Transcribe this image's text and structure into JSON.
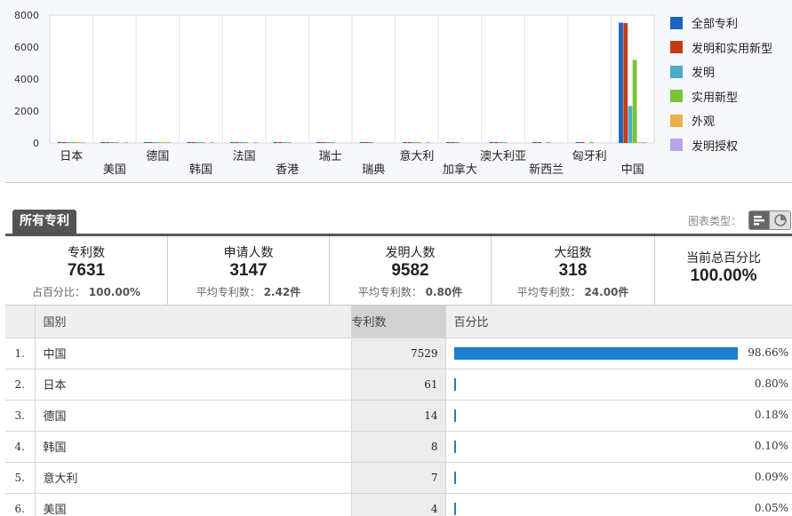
{
  "chart_data": {
    "type": "bar",
    "categories": [
      "日本",
      "美国",
      "德国",
      "韩国",
      "法国",
      "香港",
      "瑞士",
      "瑞典",
      "意大利",
      "加拿大",
      "澳大利亚",
      "新西兰",
      "匈牙利",
      "中国"
    ],
    "series": [
      {
        "name": "全部专利",
        "color": "#1b63c4",
        "values": [
          61,
          4,
          14,
          8,
          3,
          2,
          2,
          1,
          7,
          1,
          2,
          1,
          1,
          7529
        ]
      },
      {
        "name": "发明和实用新型",
        "color": "#c33b14",
        "values": [
          55,
          4,
          12,
          8,
          3,
          2,
          2,
          1,
          6,
          1,
          2,
          1,
          1,
          7500
        ]
      },
      {
        "name": "发明",
        "color": "#4bacc6",
        "values": [
          40,
          3,
          10,
          6,
          2,
          1,
          1,
          1,
          5,
          1,
          1,
          0,
          0,
          2320
        ]
      },
      {
        "name": "实用新型",
        "color": "#79c436",
        "values": [
          15,
          1,
          2,
          2,
          1,
          1,
          1,
          0,
          1,
          0,
          1,
          1,
          1,
          5200
        ]
      },
      {
        "name": "外观",
        "color": "#eab04a",
        "values": [
          2,
          0,
          1,
          0,
          0,
          0,
          0,
          0,
          0,
          0,
          0,
          0,
          0,
          29
        ]
      },
      {
        "name": "发明授权",
        "color": "#b9a4ec",
        "values": [
          10,
          1,
          3,
          2,
          1,
          0,
          0,
          0,
          1,
          0,
          0,
          0,
          0,
          20
        ]
      }
    ],
    "yticks": [
      0,
      2000,
      4000,
      6000,
      8000
    ],
    "ylim": [
      0,
      8000
    ],
    "grid": true,
    "legend": "right"
  },
  "tabs": {
    "all_label": "所有专利"
  },
  "chart_type": {
    "label": "图表类型：",
    "bar_icon": "bar-chart-icon",
    "pie_icon": "pie-chart-icon"
  },
  "stats": {
    "patents": {
      "title": "专利数",
      "value": "7631",
      "sub_label": "占百分比：",
      "sub_value": "100.00%"
    },
    "applicants": {
      "title": "申请人数",
      "value": "3147",
      "sub_label": "平均专利数：",
      "sub_value": "2.42件"
    },
    "inventors": {
      "title": "发明人数",
      "value": "9582",
      "sub_label": "平均专利数：",
      "sub_value": "0.80件"
    },
    "groups": {
      "title": "大组数",
      "value": "318",
      "sub_label": "平均专利数：",
      "sub_value": "24.00件"
    },
    "current": {
      "title": "当前总百分比",
      "value": "100.00%"
    }
  },
  "table": {
    "headers": {
      "name": "国别",
      "count": "专利数",
      "percent": "百分比"
    },
    "rows": [
      {
        "idx": "1.",
        "name": "中国",
        "count": "7529",
        "percent": "98.66%",
        "fraction": 0.9866
      },
      {
        "idx": "2.",
        "name": "日本",
        "count": "61",
        "percent": "0.80%",
        "fraction": 0.008
      },
      {
        "idx": "3.",
        "name": "德国",
        "count": "14",
        "percent": "0.18%",
        "fraction": 0.0018
      },
      {
        "idx": "4.",
        "name": "韩国",
        "count": "8",
        "percent": "0.10%",
        "fraction": 0.001
      },
      {
        "idx": "5.",
        "name": "意大利",
        "count": "7",
        "percent": "0.09%",
        "fraction": 0.0009
      },
      {
        "idx": "6.",
        "name": "美国",
        "count": "4",
        "percent": "0.05%",
        "fraction": 0.0005
      }
    ]
  }
}
